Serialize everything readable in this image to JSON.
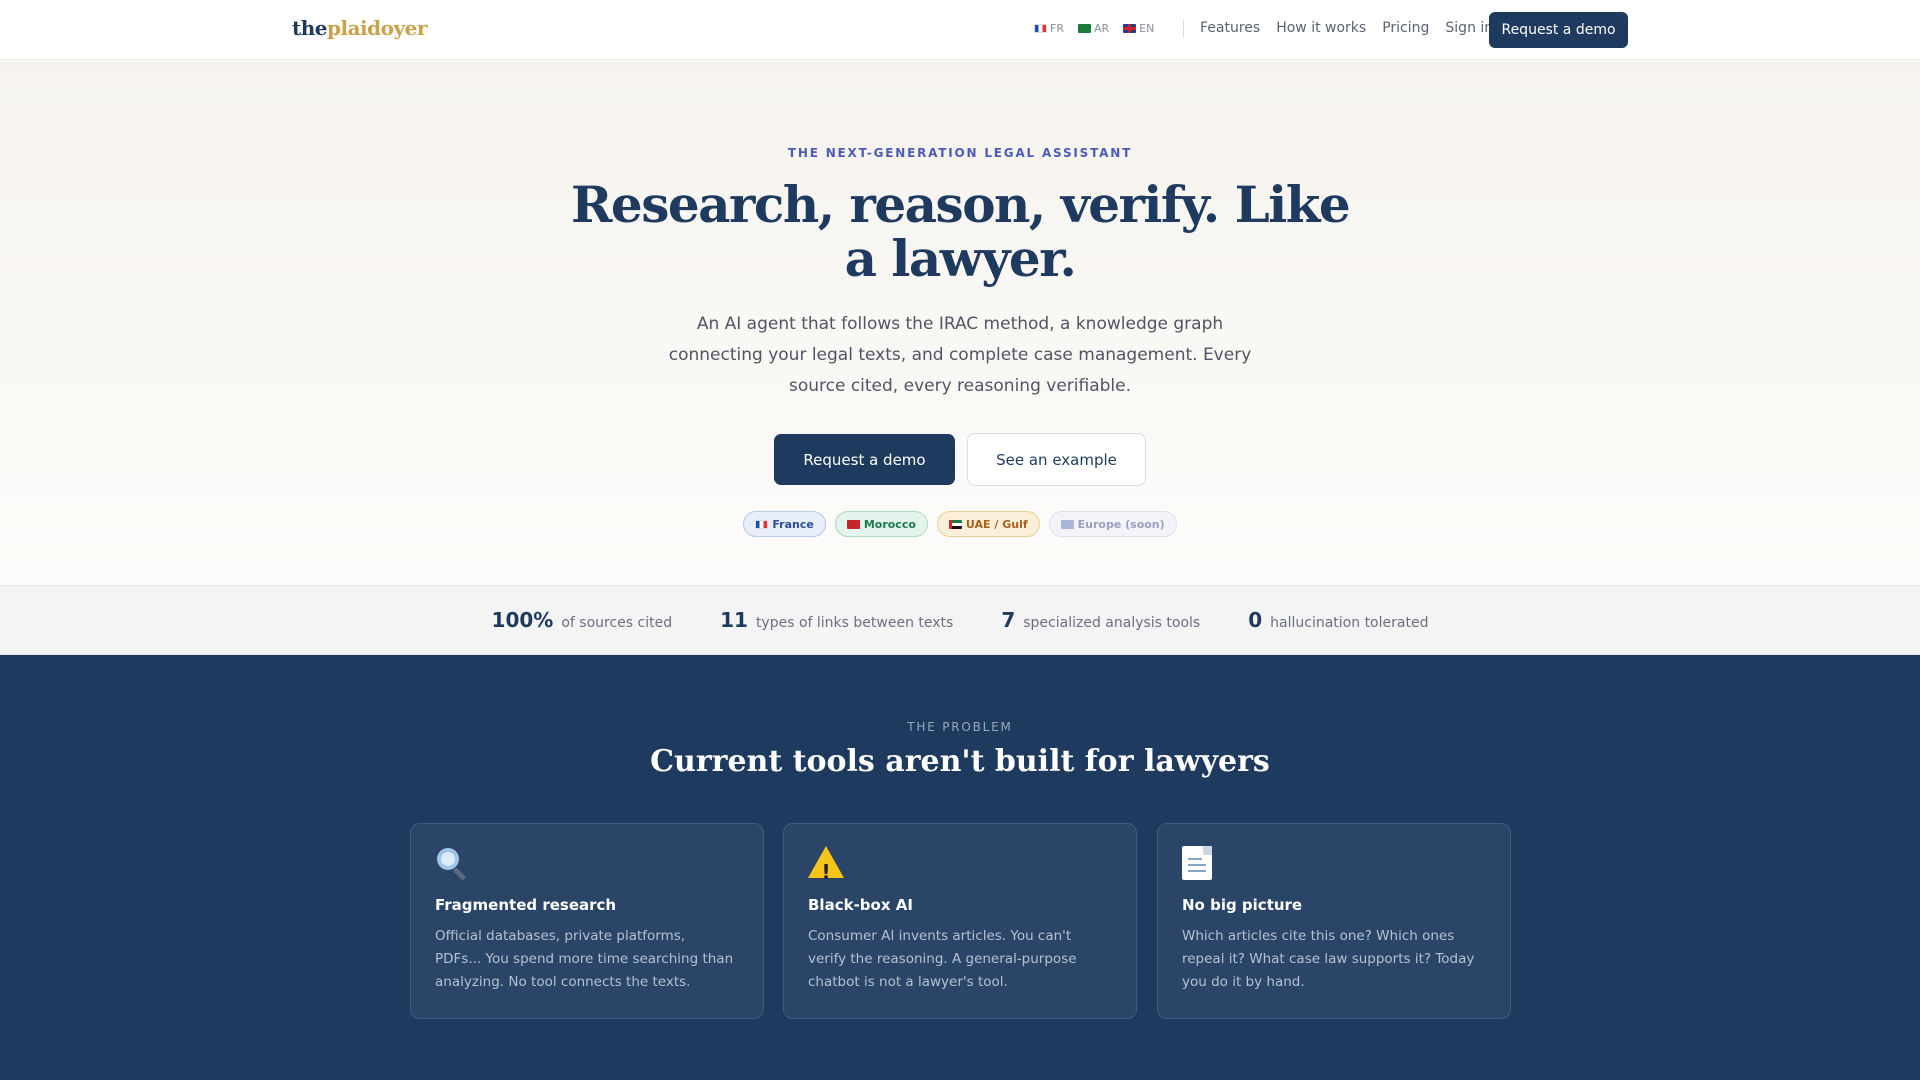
{
  "nav": {
    "logo_part1": "the",
    "logo_part2": "plaidoyer",
    "languages": [
      {
        "code": "FR",
        "icon": "france-flag-icon"
      },
      {
        "code": "AR",
        "icon": "saudi-flag-icon"
      },
      {
        "code": "EN",
        "icon": "uk-flag-icon"
      }
    ],
    "links": [
      "Features",
      "How it works",
      "Pricing",
      "Sign in"
    ],
    "cta": "Request a demo"
  },
  "hero": {
    "eyebrow": "THE NEXT-GENERATION LEGAL ASSISTANT",
    "headline": "Research, reason, verify. Like a lawyer.",
    "subtitle": "An AI agent that follows the IRAC method, a knowledge graph connecting your legal texts, and complete case management. Every source cited, every reasoning verifiable.",
    "primary_button": "Request a demo",
    "secondary_button": "See an example",
    "regions": [
      {
        "label": "France",
        "icon": "france-flag-icon"
      },
      {
        "label": "Morocco",
        "icon": "morocco-flag-icon"
      },
      {
        "label": "UAE / Gulf",
        "icon": "uae-flag-icon"
      },
      {
        "label": "Europe (soon)",
        "icon": "europe-flag-icon"
      }
    ]
  },
  "stats": [
    {
      "value": "100%",
      "label": "of sources cited"
    },
    {
      "value": "11",
      "label": "types of links between texts"
    },
    {
      "value": "7",
      "label": "specialized analysis tools"
    },
    {
      "value": "0",
      "label": "hallucination tolerated"
    }
  ],
  "problem": {
    "eyebrow": "THE PROBLEM",
    "title": "Current tools aren't built for lawyers",
    "cards": [
      {
        "icon": "magnifying-glass-icon",
        "title": "Fragmented research",
        "body": "Official databases, private platforms, PDFs... You spend more time searching than analyzing. No tool connects the texts."
      },
      {
        "icon": "warning-icon",
        "title": "Black-box AI",
        "body": "Consumer AI invents articles. You can't verify the reasoning. A general-purpose chatbot is not a lawyer's tool."
      },
      {
        "icon": "document-icon",
        "title": "No big picture",
        "body": "Which articles cite this one? Which ones repeal it? What case law supports it? Today you do it by hand."
      }
    ]
  },
  "colors": {
    "brand_navy": "#1e3a5f",
    "brand_gold": "#c9a24a",
    "eyebrow_blue": "#4b5bb8",
    "problem_bg": "#1f3a5f"
  }
}
